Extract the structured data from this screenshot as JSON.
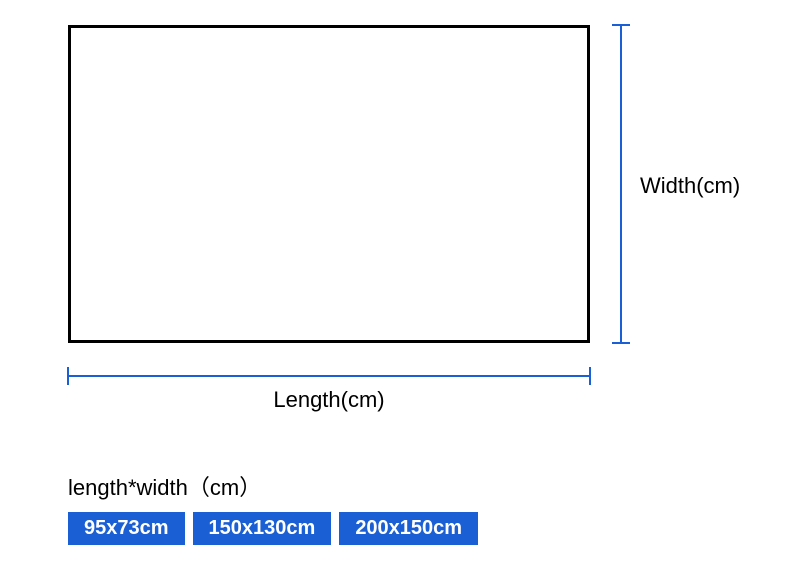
{
  "diagram": {
    "width_label": "Width(cm)",
    "length_label": "Length(cm)"
  },
  "options": {
    "title": "length*width（cm）",
    "sizes": [
      "95x73cm",
      "150x130cm",
      "200x150cm"
    ]
  },
  "colors": {
    "dimension_line": "#1a5fd4",
    "chip_bg": "#1a5fd4",
    "chip_text": "#ffffff"
  }
}
